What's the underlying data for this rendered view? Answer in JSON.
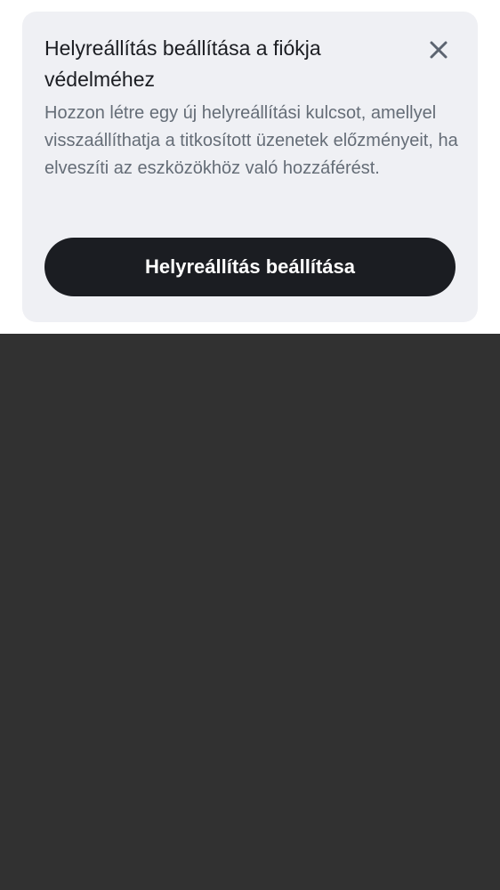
{
  "banner": {
    "title": "Helyreállítás beállítása a fiókja védelméhez",
    "description": "Hozzon létre egy új helyreállítási kulcsot, amellyel visszaállíthatja a titkosított üzenetek előzményeit, ha elveszíti az eszközökhöz való hozzáférést.",
    "button_label": "Helyreállítás beállítása",
    "close_icon": "close-icon"
  },
  "colors": {
    "card_background": "#eff0f4",
    "title": "#1b1d22",
    "description": "#656d77",
    "button_background": "#1b1d22",
    "button_text": "#ffffff",
    "lower_background": "#313131"
  }
}
